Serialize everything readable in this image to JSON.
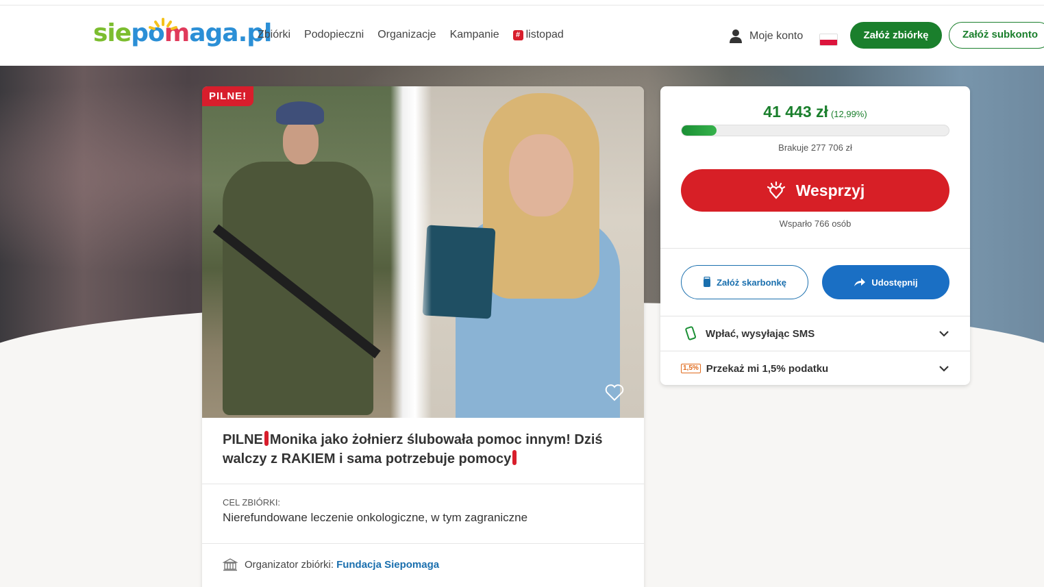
{
  "header": {
    "logo": {
      "sie": "sie",
      "po": "po",
      "m": "m",
      "aga": "aga",
      "pl": ".pl"
    },
    "nav": [
      "Zbiórki",
      "Podopieczni",
      "Organizacje",
      "Kampanie",
      "listopad"
    ],
    "account_label": "Moje konto",
    "create_fundraiser": "Załóż zbiórkę",
    "create_subaccount": "Załóż subkonto"
  },
  "fundraiser": {
    "badge": "PILNE!",
    "title_part1": "PILNE",
    "title_part2": "Monika jako żołnierz ślubowała pomoc innym! Dziś walczy z RAKIEM i sama potrzebuje pomocy",
    "goal_label": "CEL ZBIÓRKI:",
    "goal_text": "Nierefundowane leczenie onkologiczne, w tym zagraniczne",
    "organizer_label": "Organizator zbiórki:",
    "organizer_name": "Fundacja Siepomaga"
  },
  "donation": {
    "amount": "41 443 zł",
    "percent": "(12,99%)",
    "progress": 0.1299,
    "missing": "Brakuje 277 706 zł",
    "support_button": "Wesprzyj",
    "supported_by": "Wsparło 766 osób",
    "piggy_button": "Załóż skarbonkę",
    "share_button": "Udostępnij",
    "sms_label": "Wpłać, wysyłając SMS",
    "tax_badge": "1,5%",
    "tax_label": "Przekaż mi 1,5% podatku"
  },
  "colors": {
    "green": "#1a7f2c",
    "red": "#d71f26",
    "blue": "#1a6fc4"
  }
}
